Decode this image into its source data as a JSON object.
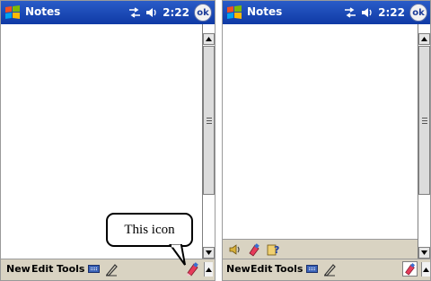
{
  "left_device": {
    "title": "Notes",
    "time": "2:22",
    "ok_label": "ok",
    "menu": {
      "new": "New",
      "edit": "Edit",
      "tools": "Tools"
    },
    "callout_text": "This icon"
  },
  "right_device": {
    "title": "Notes",
    "time": "2:22",
    "ok_label": "ok",
    "menu": {
      "new": "New",
      "edit": "Edit",
      "tools": "Tools"
    },
    "tray_icons": [
      "speaker-icon",
      "input-method-icon",
      "help-icon"
    ]
  },
  "colors": {
    "titlebar": "#1f4cba",
    "menubar": "#d9d3c2",
    "callout_border": "#000000"
  }
}
